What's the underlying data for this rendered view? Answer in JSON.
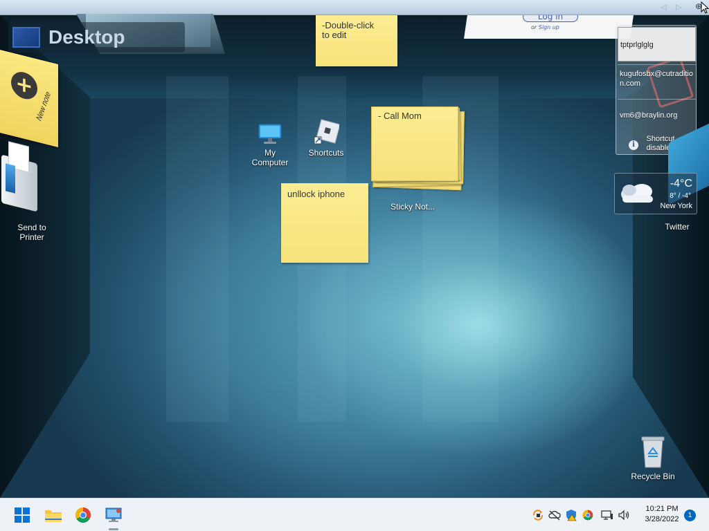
{
  "desktop": {
    "title": "Desktop",
    "icons": {
      "my_computer": "My\nComputer",
      "shortcuts": "Shortcuts",
      "send_to_printer": "Send to\nPrinter",
      "sticky_notes": "Sticky Not...",
      "recycle_bin": "Recycle Bin",
      "twitter": "Twitter"
    }
  },
  "sticky_notes": {
    "top_note": "-Double-click\n to edit",
    "stack_note": "- Call Mom",
    "middle_note": "unllock iphone",
    "new_note": "New note"
  },
  "login_card": {
    "login_label": "Log in",
    "or_text": "or",
    "signup_label": "Sign up"
  },
  "accounts_panel": {
    "accounts": [
      "tptprlglglg",
      "kugufosbx@cutradition.com",
      "vm6@braylin.org"
    ],
    "shortcut_disabled": "Shortcut\ndisabled"
  },
  "weather": {
    "temperature": "-4°C",
    "range": "8° / -4°",
    "city": "New York"
  },
  "taskbar": {
    "time": "10:21 PM",
    "date": "3/28/2022",
    "notification_count": "1"
  },
  "colors": {
    "taskbar_bg": "#eef2f7",
    "sticky_yellow": "#fbed93",
    "accent_blue": "#0067c0"
  }
}
